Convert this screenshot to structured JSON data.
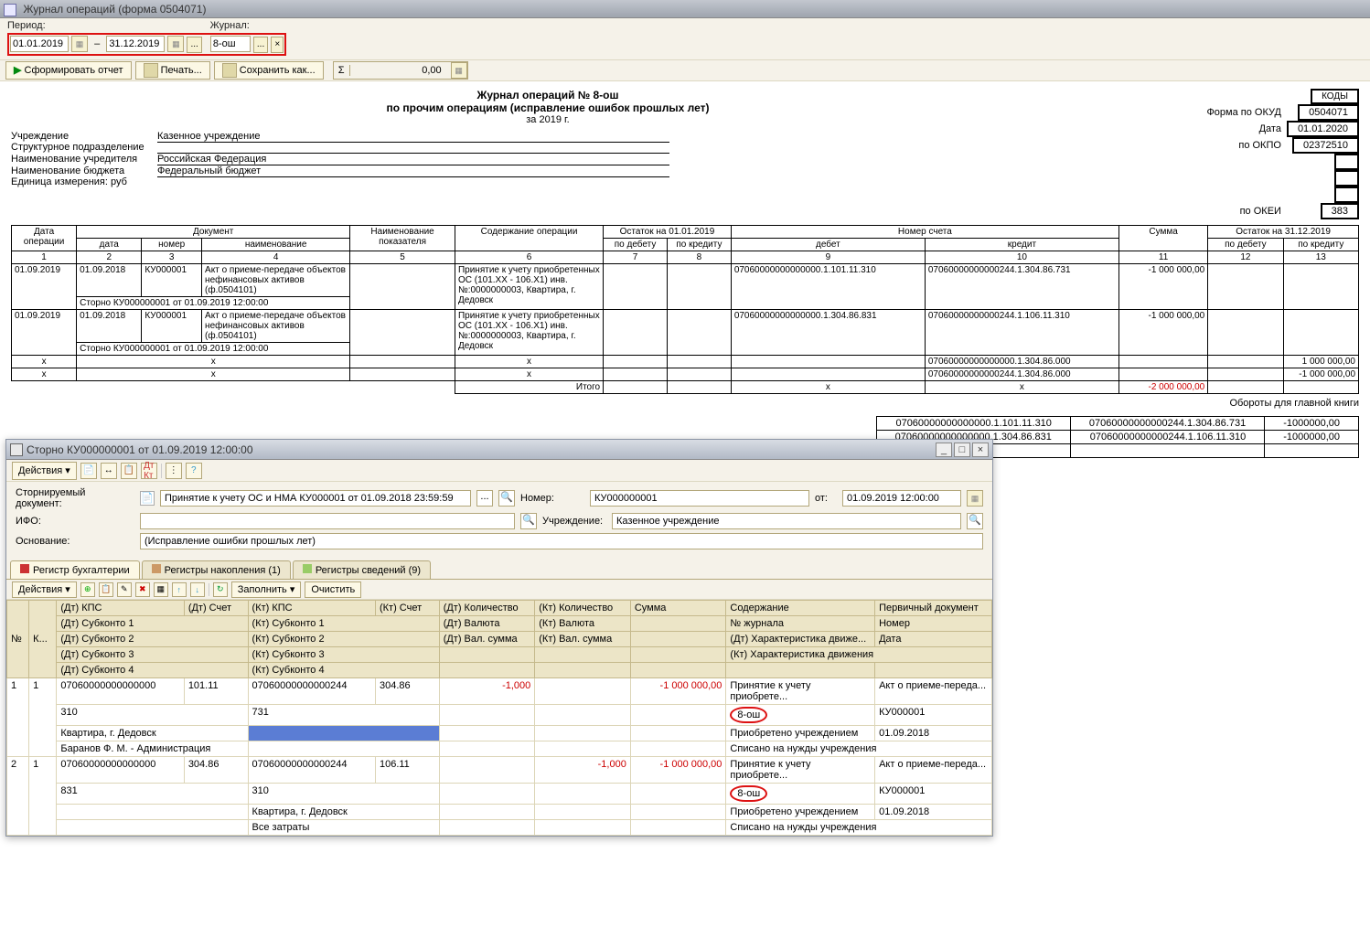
{
  "titlebar": {
    "title": "Журнал операций (форма 0504071)"
  },
  "period": {
    "lbl_period": "Период:",
    "lbl_journal": "Журнал:",
    "from": "01.01.2019",
    "to": "31.12.2019",
    "journal": "8-ош"
  },
  "toolbar": {
    "generate": "Сформировать отчет",
    "print": "Печать...",
    "save": "Сохранить как...",
    "sum": "0,00"
  },
  "report": {
    "title": "Журнал операций № 8-ош",
    "subtitle": "по прочим операциям (исправление ошибок прошлых лет)",
    "year": "за 2019 г.",
    "labels": {
      "inst": "Учреждение",
      "struct": "Структурное подразделение",
      "founder": "Наименование учредителя",
      "budget": "Наименование бюджета",
      "unit": "Единица измерения: руб"
    },
    "values": {
      "inst": "Казенное учреждение",
      "struct": "",
      "founder": "Российская Федерация",
      "budget": "Федеральный бюджет"
    },
    "codes": {
      "hdr": "КОДЫ",
      "okud_lbl": "Форма по ОКУД",
      "okud": "0504071",
      "date_lbl": "Дата",
      "date": "01.01.2020",
      "okpo_lbl": "по ОКПО",
      "okpo": "02372510",
      "okei_lbl": "по ОКЕИ",
      "okei": "383"
    }
  },
  "columns": {
    "op_date": "Дата операции",
    "doc": "Документ",
    "doc_date": "дата",
    "doc_num": "номер",
    "doc_name": "наименование",
    "indicator": "Наименование показателя",
    "content": "Содержание операции",
    "bal_start": "Остаток на 01.01.2019",
    "debit": "по дебету",
    "credit": "по кредиту",
    "account": "Номер счета",
    "acc_debit": "дебет",
    "acc_credit": "кредит",
    "sum": "Сумма",
    "bal_end": "Остаток на 31.12.2019",
    "itogo": "Итого",
    "nums": [
      "1",
      "2",
      "3",
      "4",
      "5",
      "6",
      "7",
      "8",
      "9",
      "10",
      "11",
      "12",
      "13"
    ]
  },
  "rows": [
    {
      "op_date": "01.09.2019",
      "doc_date": "01.09.2018",
      "doc_num": "КУ000001",
      "doc_name": "Акт о приеме-передаче объектов нефинансовых активов (ф.0504101)",
      "storno": "Сторно КУ000000001 от 01.09.2019 12:00:00",
      "content": "Принятие к учету приобретенных ОС (101.ХХ - 106.Х1) инв.№:0000000003, Квартира, г. Дедовск",
      "debit": "07060000000000000.1.101.11.310",
      "credit": "07060000000000244.1.304.86.731",
      "sum": "-1 000 000,00"
    },
    {
      "op_date": "01.09.2019",
      "doc_date": "01.09.2018",
      "doc_num": "КУ000001",
      "doc_name": "Акт о приеме-передаче объектов нефинансовых активов (ф.0504101)",
      "storno": "Сторно КУ000000001 от 01.09.2019 12:00:00",
      "content": "Принятие к учету приобретенных ОС (101.ХХ - 106.Х1) инв.№:0000000003, Квартира, г. Дедовск",
      "debit": "07060000000000000.1.304.86.831",
      "credit": "07060000000000244.1.106.11.310",
      "sum": "-1 000 000,00"
    }
  ],
  "totals": [
    {
      "credit": "07060000000000000.1.304.86.000",
      "end_credit": "1 000 000,00"
    },
    {
      "credit": "07060000000000244.1.304.86.000",
      "end_credit": "-1 000 000,00"
    }
  ],
  "grand_total": "-2 000 000,00",
  "turnover": {
    "hdr": "Обороты для главной книги",
    "rows": [
      {
        "d": "07060000000000000.1.101.11.310",
        "c": "07060000000000244.1.304.86.731",
        "s": "-1000000,00"
      },
      {
        "d": "07060000000000000.1.304.86.831",
        "c": "07060000000000244.1.106.11.310",
        "s": "-1000000,00"
      }
    ]
  },
  "subwin": {
    "title": "Сторно КУ000000001 от 01.09.2019 12:00:00",
    "actions": "Действия",
    "form": {
      "stor_doc_lbl": "Сторнируемый документ:",
      "stor_doc": "Принятие к учету ОС и НМА КУ000001 от 01.09.2018 23:59:59",
      "num_lbl": "Номер:",
      "num": "КУ000000001",
      "ot": "от:",
      "date": "01.09.2019 12:00:00",
      "ifo_lbl": "ИФО:",
      "ifo": "",
      "inst_lbl": "Учреждение:",
      "inst": "Казенное учреждение",
      "reason_lbl": "Основание:",
      "reason": "(Исправление ошибки прошлых лет)"
    },
    "tabs": {
      "t1": "Регистр бухгалтерии",
      "t2": "Регистры накопления (1)",
      "t3": "Регистры сведений (9)"
    },
    "gridtb": {
      "actions": "Действия",
      "fill": "Заполнить",
      "clear": "Очистить"
    },
    "gh": {
      "n": "№",
      "k": "К...",
      "dt_kps": "(Дт) КПС",
      "dt_schet": "(Дт) Счет",
      "kt_kps": "(Кт) КПС",
      "kt_schet": "(Кт) Счет",
      "dt_kol": "(Дт) Количество",
      "kt_kol": "(Кт) Количество",
      "sum": "Сумма",
      "content": "Содержание",
      "prim": "Первичный документ",
      "dt_sub1": "(Дт) Субконто 1",
      "kt_sub1": "(Кт) Субконто 1",
      "dt_val": "(Дт) Валюта",
      "kt_val": "(Кт) Валюта",
      "nzh": "№ журнала",
      "nomer": "Номер",
      "dt_sub2": "(Дт) Субконто 2",
      "kt_sub2": "(Кт) Субконто 2",
      "dt_vs": "(Дт) Вал. сумма",
      "kt_vs": "(Кт) Вал. сумма",
      "dt_har": "(Дт) Характеристика движе...",
      "data": "Дата",
      "dt_sub3": "(Дт) Субконто 3",
      "kt_sub3": "(Кт) Субконто 3",
      "kt_har": "(Кт) Характеристика движения",
      "dt_sub4": "(Дт) Субконто 4",
      "kt_sub4": "(Кт) Субконто 4"
    },
    "grows": [
      {
        "n": "1",
        "k": "1",
        "r1": {
          "dt_kps": "07060000000000000",
          "dt_schet": "101.11",
          "kt_kps": "07060000000000244",
          "kt_schet": "304.86",
          "dt_kol": "-1,000",
          "sum": "-1 000 000,00",
          "content": "Принятие к учету приобрете...",
          "prim": "Акт о приеме-переда..."
        },
        "r2": {
          "dt_sub1": "310",
          "kt_sub1": "731",
          "nzh": "8-ош",
          "nomer": "КУ000001"
        },
        "r3": {
          "dt_sub2": "Квартира, г. Дедовск",
          "dt_har": "Приобретено учреждением",
          "data": "01.09.2018"
        },
        "r4": {
          "dt_sub3": "Баранов Ф. М. - Администрация",
          "kt_har": "Списано на нужды учреждения"
        }
      },
      {
        "n": "2",
        "k": "1",
        "r1": {
          "dt_kps": "07060000000000000",
          "dt_schet": "304.86",
          "kt_kps": "07060000000000244",
          "kt_schet": "106.11",
          "kt_kol": "-1,000",
          "sum": "-1 000 000,00",
          "content": "Принятие к учету приобрете...",
          "prim": "Акт о приеме-переда..."
        },
        "r2": {
          "dt_sub1": "831",
          "kt_sub1": "310",
          "nzh": "8-ош",
          "nomer": "КУ000001"
        },
        "r3": {
          "kt_sub2": "Квартира, г. Дедовск",
          "dt_har": "Приобретено учреждением",
          "data": "01.09.2018"
        },
        "r4": {
          "kt_sub3": "Все затраты",
          "kt_har": "Списано на нужды учреждения"
        }
      }
    ]
  }
}
